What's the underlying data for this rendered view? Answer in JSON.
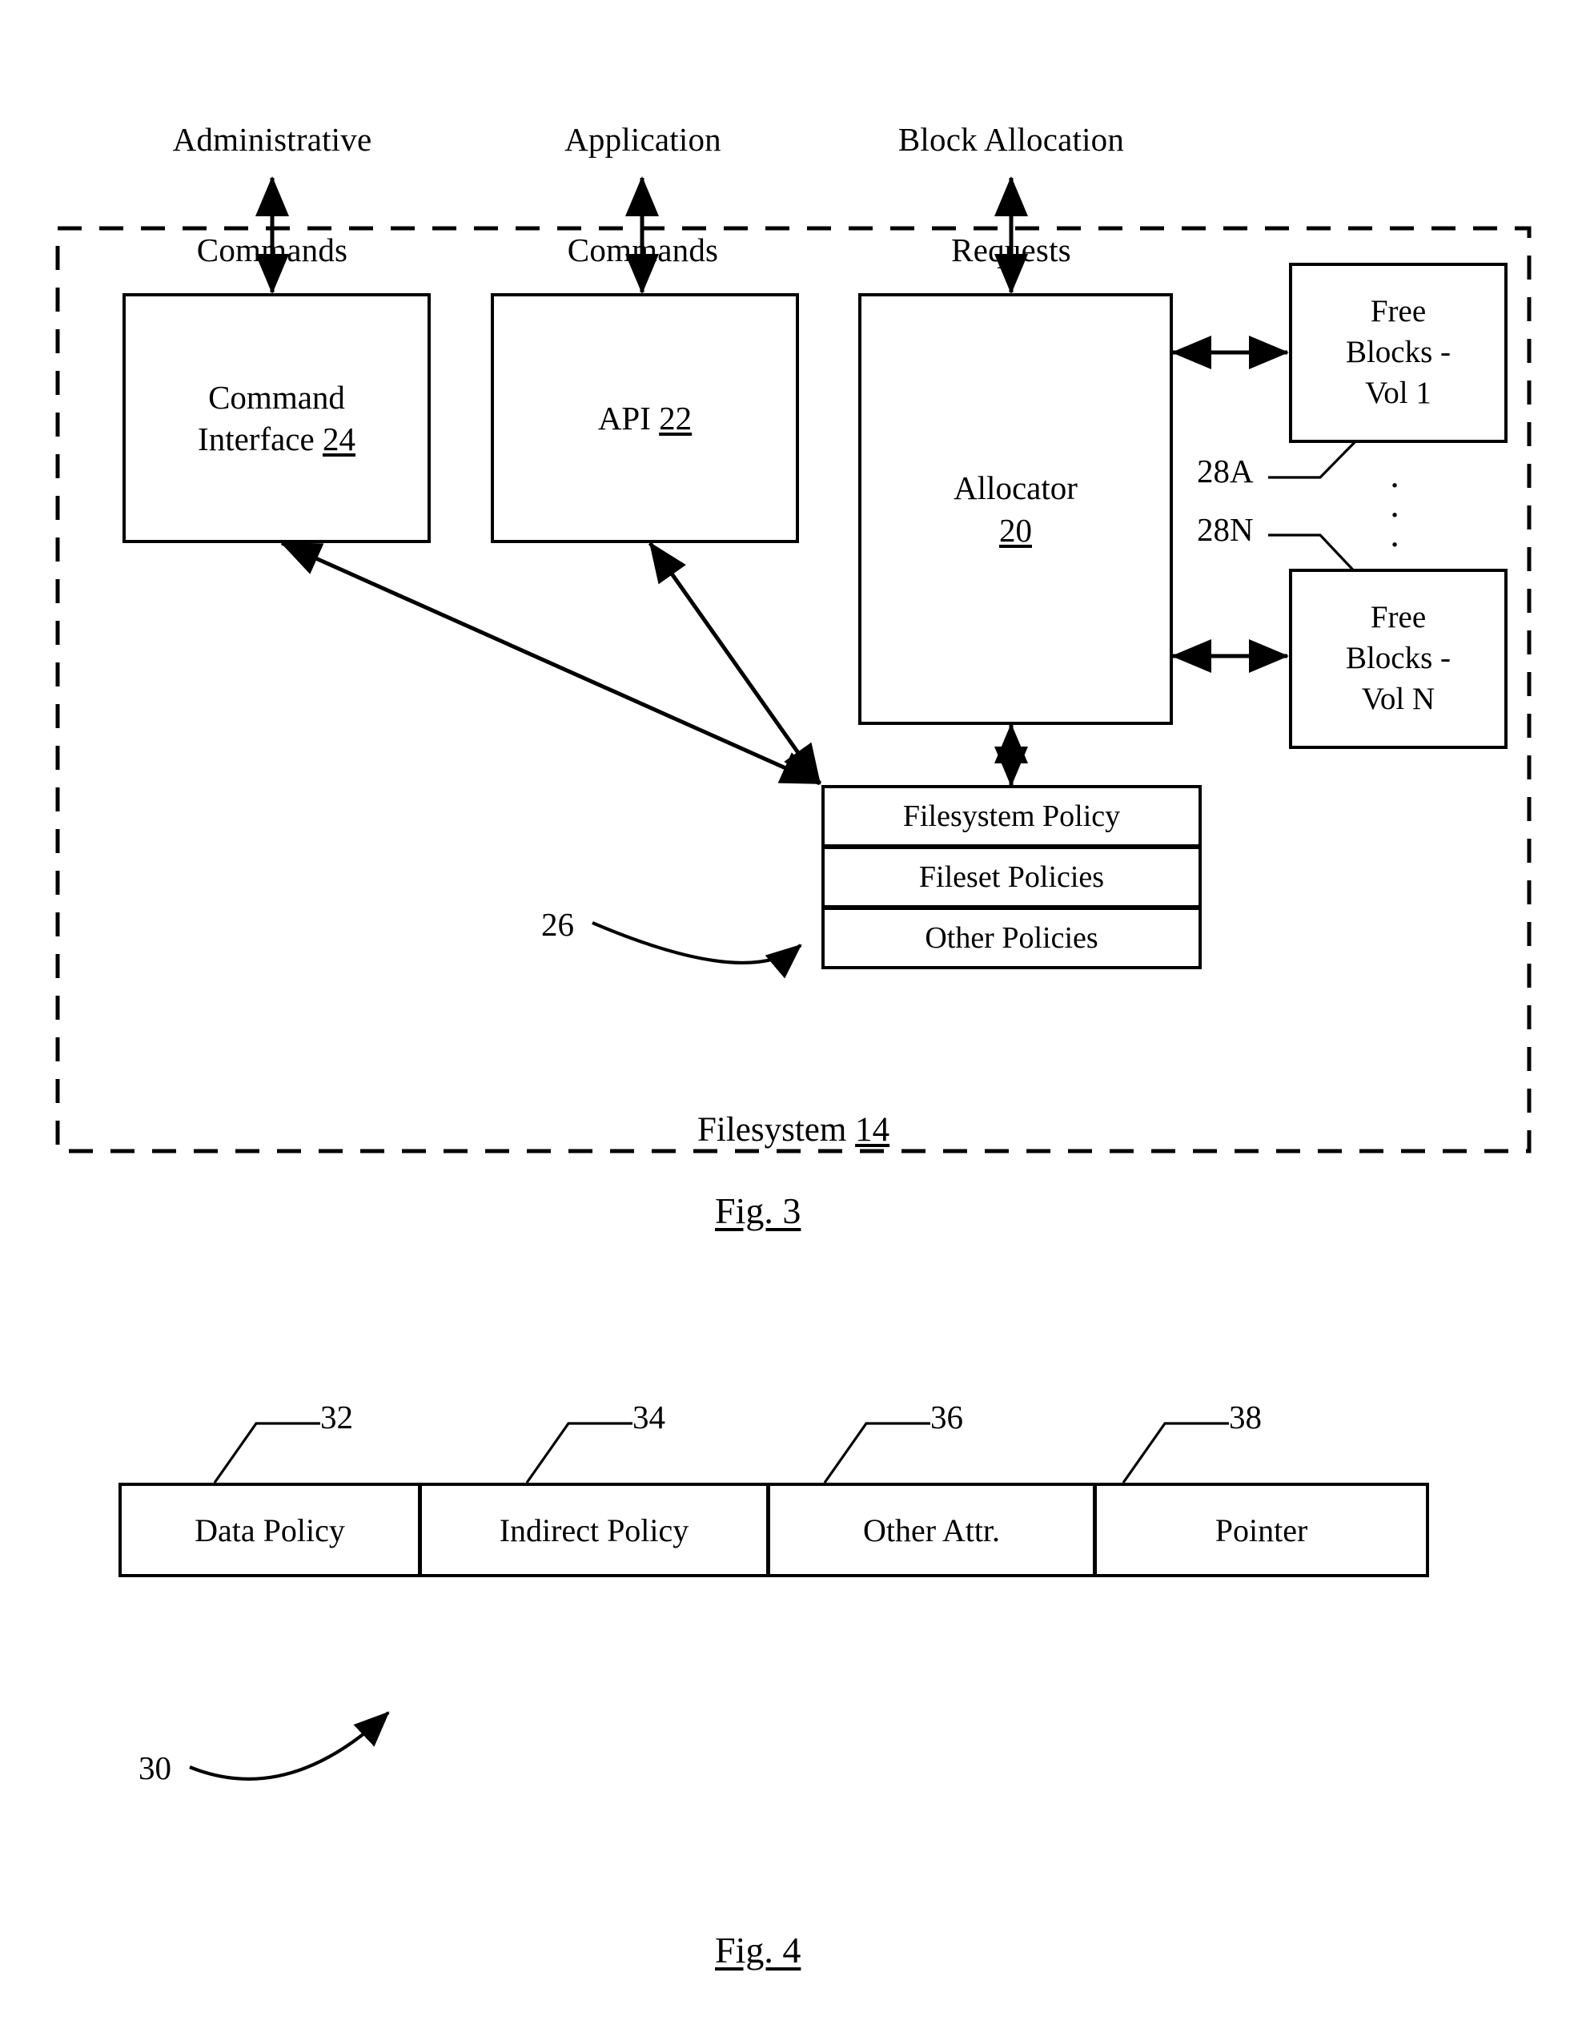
{
  "figure3": {
    "caption": "Fig. 3",
    "external_inputs": [
      {
        "id": "administrative-commands",
        "line1": "Administrative",
        "line2": "Commands"
      },
      {
        "id": "application-commands",
        "line1": "Application",
        "line2": "Commands"
      },
      {
        "id": "block-allocation-requests",
        "line1": "Block Allocation",
        "line2": "Requests"
      }
    ],
    "container": {
      "label_text": "Filesystem",
      "label_ref": "14"
    },
    "blocks": [
      {
        "id": "command-interface",
        "line1": "Command",
        "line2": "Interface",
        "ref": "24"
      },
      {
        "id": "api",
        "line1": "API",
        "line2": "",
        "ref": "22"
      },
      {
        "id": "allocator",
        "line1": "Allocator",
        "line2": "",
        "ref": "20"
      }
    ],
    "free_block_boxes": [
      {
        "id": "free-blocks-vol-1",
        "line1": "Free",
        "line2": "Blocks -",
        "line3": "Vol 1",
        "ref": "28A"
      },
      {
        "id": "free-blocks-vol-n",
        "line1": "Free",
        "line2": "Blocks -",
        "line3": "Vol N",
        "ref": "28N"
      }
    ],
    "vertical_ellipsis": "·\n·\n·",
    "policy_stack": {
      "ref": "26",
      "rows": [
        {
          "id": "filesystem-policy",
          "label": "Filesystem Policy"
        },
        {
          "id": "fileset-policies",
          "label": "Fileset Policies"
        },
        {
          "id": "other-policies",
          "label": "Other Policies"
        }
      ]
    }
  },
  "figure4": {
    "caption": "Fig. 4",
    "structure_ref": "30",
    "fields": [
      {
        "id": "data-policy",
        "label": "Data Policy",
        "ref": "32"
      },
      {
        "id": "indirect-policy",
        "label": "Indirect Policy",
        "ref": "34"
      },
      {
        "id": "other-attr",
        "label": "Other Attr.",
        "ref": "36"
      },
      {
        "id": "pointer",
        "label": "Pointer",
        "ref": "38"
      }
    ]
  },
  "style": {
    "ink": "#000000",
    "paper": "#ffffff"
  }
}
